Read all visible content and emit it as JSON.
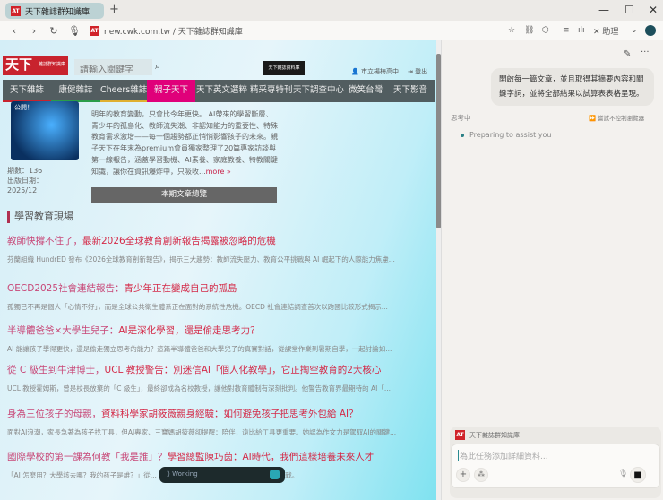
{
  "browser": {
    "tab_title": "天下雜誌群知識庫",
    "favicon": "天下",
    "url_domain": "new.cwk.com.tw",
    "url_title": "天下雜誌群知識庫",
    "assistant_btn": "助理"
  },
  "site": {
    "logo": "天下",
    "logo_sub": "雜誌群知識庫",
    "search_placeholder": "請輸入關鍵字",
    "ad": "天下雜誌資料庫",
    "user": "市立楊梅高中",
    "logout": "登出",
    "nav": [
      "天下雜誌",
      "康健雜誌",
      "Cheers雜誌",
      "親子天下",
      "天下英文選粹",
      "精采專特刊",
      "天下調查中心",
      "微笑台灣",
      "天下影音"
    ],
    "cover_badge": "公開！",
    "description": "明年的教育變動，只會比今年更快。 AI帶來的學習斷層、青少年的孤島化、教師流失潮、非認知能力的重要性、特殊教育需求激增——每一個趨勢都正悄悄影響孩子的未來。親子天下在年末為premium會員獨家整理了20篇專家訪談與第一線報告，涵蓋學習動機、AI素養、家庭教養、特教關鍵知識，讓你在資訊爆炸中，只吸收...",
    "more": "more »",
    "issue": "期數：136",
    "pubdate_label": "出版日期：",
    "pubdate": "2025/12",
    "overview_btn": "本期文章總覽",
    "section": "學習教育現場",
    "articles": [
      {
        "t1": "教師快撐不住了，",
        "t2": "最新2026全球教育創新報告揭露被忽略的危機",
        "s": "芬蘭組織 HundrED 發布《2026全球教育創新報告》，揭示三大趨勢：教師流失壓力、教育公平挑戰與 AI 崛起下的人際能力焦慮..."
      },
      {
        "t1": "OECD2025社會連結報告：",
        "t2": "青少年正在變成自己的孤島",
        "s": "孤獨已不再是個人「心情不好」，而是全球公共衛生體系正在面對的系統性危機。OECD 社會連結調查首次以跨國比較形式揭示..."
      },
      {
        "t1": "半導體爸爸×大學生兒子：",
        "t2": "AI是深化學習，還是偷走思考力？",
        "s": "AI 能讓孩子學得更快，還是偷走獨立思考的能力？這篇半導體爸爸和大學兒子的真實對話，從課堂作業到暑期自學，一起討論如..."
      },
      {
        "t1": "從 C 級生到牛津博士，",
        "t2": "UCL 教授警告：別迷信AI「個人化教學」，它正掏空教育的2大核心",
        "s": "UCL 教授霍姆斯，曾是校長放棄的「C 級生」，最終卻成為名校教授，讓他對教育體制有深刻批判。他警告教育界最期待的 AI「..."
      },
      {
        "t1": "身為三位孩子的母親，",
        "t2": "資料科學家胡筱薇親身經驗：如何避免孩子把思考外包給 AI？",
        "s": "面對AI浪潮，家長急著為孩子找工具，但AI專家、三寶媽胡筱薇卻提醒：陪伴，遠比給工具更重要。她認為作文力是駕馭AI的關鍵..."
      },
      {
        "t1": "國際學校的第一課為何教「我是誰」？",
        "t2": "學習總監陳巧茵：AI時代，我們這樣培養未來人才",
        "s": "「AI 怎麼用？大學該去哪？我的孩子是誰？」從...（Rita），直面 AI 時代家長最關心的三大挑戰。"
      }
    ]
  },
  "overlay": {
    "working": "Working"
  },
  "assistant": {
    "user_message": "開啟每一篇文章，並且取得其摘要內容和關鍵字詞，並將全部結果以試算表表格呈現。",
    "thinking": "思考中",
    "try_label": "嘗試不控制瀏覽器",
    "status": "Preparing to assist you",
    "context_tab": "天下雜誌群知識庫",
    "input_placeholder": "為此任務添加詳細資料..."
  },
  "colors": {
    "accent": "#d42a48",
    "nav_active": "#e0007a"
  }
}
